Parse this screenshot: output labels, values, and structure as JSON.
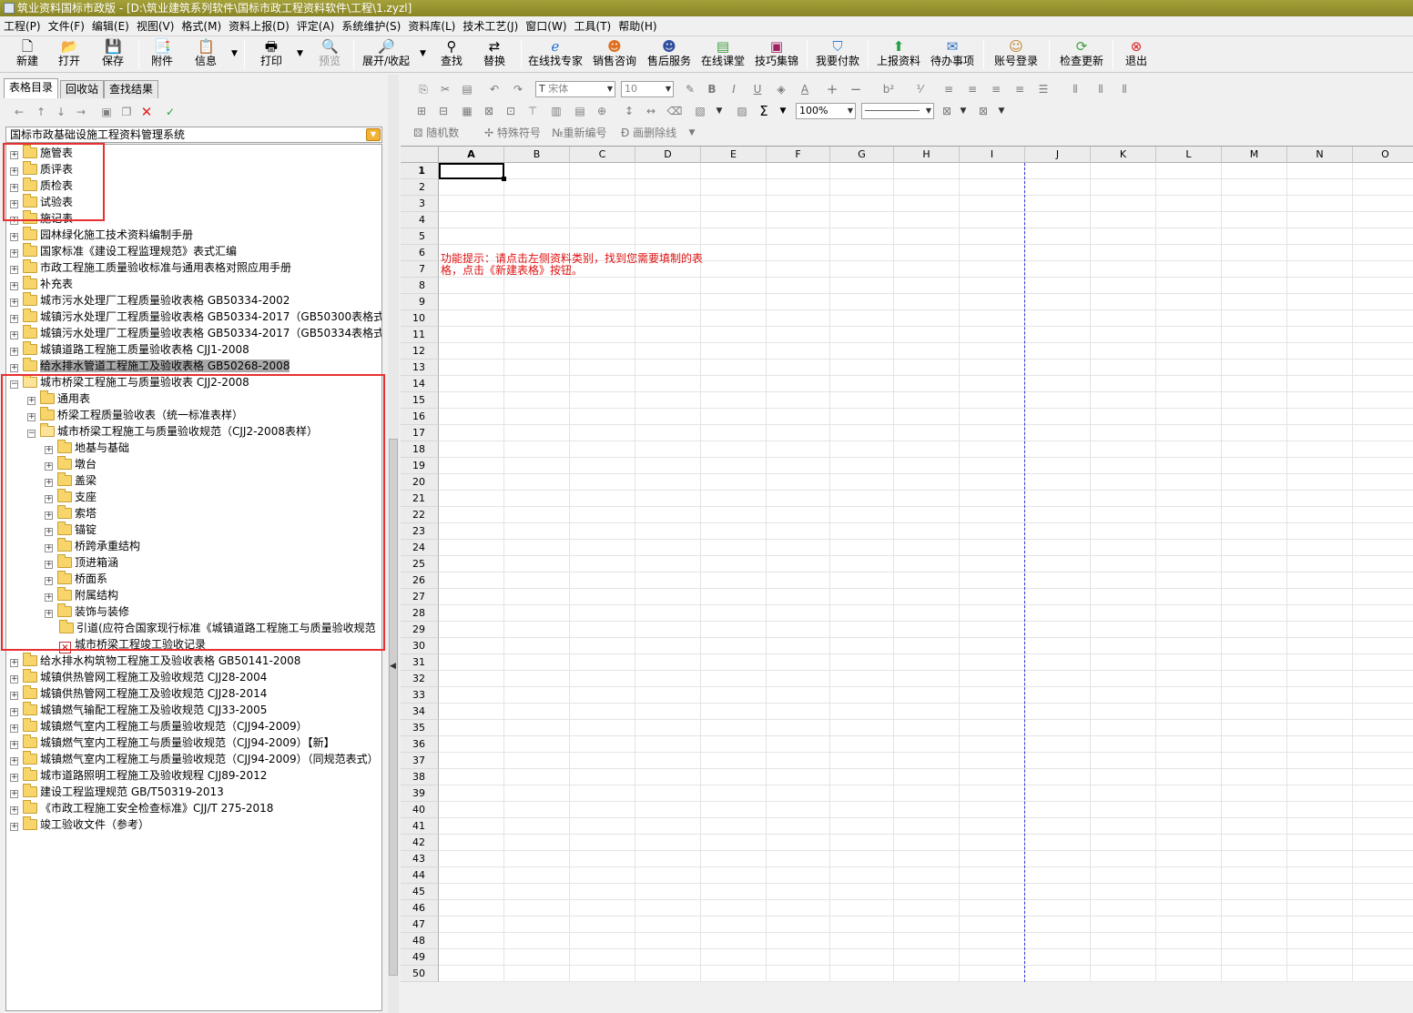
{
  "window": {
    "title": "筑业资料国标市政版 - [D:\\筑业建筑系列软件\\国标市政工程资料软件\\工程\\1.zyzl]"
  },
  "menu": [
    "工程(P)",
    "文件(F)",
    "编辑(E)",
    "视图(V)",
    "格式(M)",
    "资料上报(D)",
    "评定(A)",
    "系统维护(S)",
    "资料库(L)",
    "技术工艺(J)",
    "窗口(W)",
    "工具(T)",
    "帮助(H)"
  ],
  "toolbar": {
    "new": "新建",
    "open": "打开",
    "save": "保存",
    "attach": "附件",
    "info": "信息",
    "print": "打印",
    "preview": "预览",
    "expand": "展开/收起",
    "find": "查找",
    "replace": "替换",
    "expert": "在线找专家",
    "sales": "销售咨询",
    "service": "售后服务",
    "classroom": "在线课堂",
    "tips": "技巧集锦",
    "pay": "我要付款",
    "upload": "上报资料",
    "todo": "待办事项",
    "account": "账号登录",
    "update": "检查更新",
    "exit": "退出"
  },
  "left": {
    "tabs": [
      "表格目录",
      "回收站",
      "查找结果"
    ],
    "system_combo": "国标市政基础设施工程资料管理系统",
    "tree": [
      {
        "label": "施管表",
        "level": 0,
        "type": "folder",
        "expander": "+"
      },
      {
        "label": "质评表",
        "level": 0,
        "type": "folder",
        "expander": "+"
      },
      {
        "label": "质检表",
        "level": 0,
        "type": "folder",
        "expander": "+"
      },
      {
        "label": "试验表",
        "level": 0,
        "type": "folder",
        "expander": "+"
      },
      {
        "label": "施记表",
        "level": 0,
        "type": "folder",
        "expander": "+"
      },
      {
        "label": "园林绿化施工技术资料编制手册",
        "level": 0,
        "type": "folder",
        "expander": "+"
      },
      {
        "label": "国家标准《建设工程监理规范》表式汇编",
        "level": 0,
        "type": "folder",
        "expander": "+"
      },
      {
        "label": "市政工程施工质量验收标准与通用表格对照应用手册",
        "level": 0,
        "type": "folder",
        "expander": "+"
      },
      {
        "label": "补充表",
        "level": 0,
        "type": "folder",
        "expander": "+"
      },
      {
        "label": "城市污水处理厂工程质量验收表格 GB50334-2002",
        "level": 0,
        "type": "folder",
        "expander": "+"
      },
      {
        "label": "城镇污水处理厂工程质量验收表格 GB50334-2017（GB50300表格式样）",
        "level": 0,
        "type": "folder",
        "expander": "+"
      },
      {
        "label": "城镇污水处理厂工程质量验收表格 GB50334-2017（GB50334表格式样）",
        "level": 0,
        "type": "folder",
        "expander": "+"
      },
      {
        "label": "城镇道路工程施工质量验收表格 CJJ1-2008",
        "level": 0,
        "type": "folder",
        "expander": "+"
      },
      {
        "label": "给水排水管道工程施工及验收表格 GB50268-2008",
        "level": 0,
        "type": "folder",
        "expander": "+",
        "selected": true
      },
      {
        "label": "城市桥梁工程施工与质量验收表 CJJ2-2008",
        "level": 0,
        "type": "folder-open",
        "expander": "-"
      },
      {
        "label": "通用表",
        "level": 1,
        "type": "folder",
        "expander": "+"
      },
      {
        "label": "桥梁工程质量验收表（统一标准表样）",
        "level": 1,
        "type": "folder",
        "expander": "+"
      },
      {
        "label": "城市桥梁工程施工与质量验收规范（CJJ2-2008表样）",
        "level": 1,
        "type": "folder-open",
        "expander": "-"
      },
      {
        "label": "地基与基础",
        "level": 2,
        "type": "folder",
        "expander": "+"
      },
      {
        "label": "墩台",
        "level": 2,
        "type": "folder",
        "expander": "+"
      },
      {
        "label": "盖梁",
        "level": 2,
        "type": "folder",
        "expander": "+"
      },
      {
        "label": "支座",
        "level": 2,
        "type": "folder",
        "expander": "+"
      },
      {
        "label": "索塔",
        "level": 2,
        "type": "folder",
        "expander": "+"
      },
      {
        "label": "锚锭",
        "level": 2,
        "type": "folder",
        "expander": "+"
      },
      {
        "label": "桥跨承重结构",
        "level": 2,
        "type": "folder",
        "expander": "+"
      },
      {
        "label": "顶进箱涵",
        "level": 2,
        "type": "folder",
        "expander": "+"
      },
      {
        "label": "桥面系",
        "level": 2,
        "type": "folder",
        "expander": "+"
      },
      {
        "label": "附属结构",
        "level": 2,
        "type": "folder",
        "expander": "+"
      },
      {
        "label": "装饰与装修",
        "level": 2,
        "type": "folder",
        "expander": "+"
      },
      {
        "label": "引道(应符合国家现行标准《城镇道路工程施工与质量验收规范",
        "level": 2,
        "type": "folder",
        "expander": ""
      },
      {
        "label": "城市桥梁工程竣工验收记录",
        "level": 2,
        "type": "file",
        "expander": ""
      },
      {
        "label": "给水排水构筑物工程施工及验收表格 GB50141-2008",
        "level": 0,
        "type": "folder",
        "expander": "+"
      },
      {
        "label": "城镇供热管网工程施工及验收规范 CJJ28-2004",
        "level": 0,
        "type": "folder",
        "expander": "+"
      },
      {
        "label": "城镇供热管网工程施工及验收规范 CJJ28-2014",
        "level": 0,
        "type": "folder",
        "expander": "+"
      },
      {
        "label": "城镇燃气输配工程施工及验收规范 CJJ33-2005",
        "level": 0,
        "type": "folder",
        "expander": "+"
      },
      {
        "label": "城镇燃气室内工程施工与质量验收规范（CJJ94-2009）",
        "level": 0,
        "type": "folder",
        "expander": "+"
      },
      {
        "label": "城镇燃气室内工程施工与质量验收规范（CJJ94-2009）【新】",
        "level": 0,
        "type": "folder",
        "expander": "+"
      },
      {
        "label": "城镇燃气室内工程施工与质量验收规范（CJJ94-2009）（同规范表式）",
        "level": 0,
        "type": "folder",
        "expander": "+"
      },
      {
        "label": "城市道路照明工程施工及验收规程 CJJ89-2012",
        "level": 0,
        "type": "folder",
        "expander": "+"
      },
      {
        "label": "建设工程监理规范 GB/T50319-2013",
        "level": 0,
        "type": "folder",
        "expander": "+"
      },
      {
        "label": "《市政工程施工安全检查标准》CJJ/T 275-2018",
        "level": 0,
        "type": "folder",
        "expander": "+"
      },
      {
        "label": "竣工验收文件（参考）",
        "level": 0,
        "type": "folder",
        "expander": "+"
      }
    ]
  },
  "right": {
    "font_name": "宋体",
    "font_size": "10",
    "zoom": "100%",
    "sum_symbol": "Σ",
    "format_labels": {
      "b": "B",
      "i": "I",
      "u": "U",
      "a": "A",
      "plus": "+",
      "minus": "−",
      "sup": "b²"
    },
    "row3": {
      "random": "随机数",
      "special": "特殊符号",
      "renumber": "重新编号",
      "strike": "画删除线"
    },
    "columns": [
      "A",
      "B",
      "C",
      "D",
      "E",
      "F",
      "G",
      "H",
      "I",
      "J",
      "K",
      "L",
      "M",
      "N",
      "O"
    ],
    "row_count": 50,
    "hint": "功能提示：请点击左侧资料类别，找到您需要填制的表格，点击《新建表格》按钮。"
  },
  "colors": {
    "title_bar": "#a4a03a",
    "highlight_box": "#e83030",
    "hint_text": "#e01010",
    "page_break": "#3030e0",
    "selected_row": "#a8a8a8"
  }
}
